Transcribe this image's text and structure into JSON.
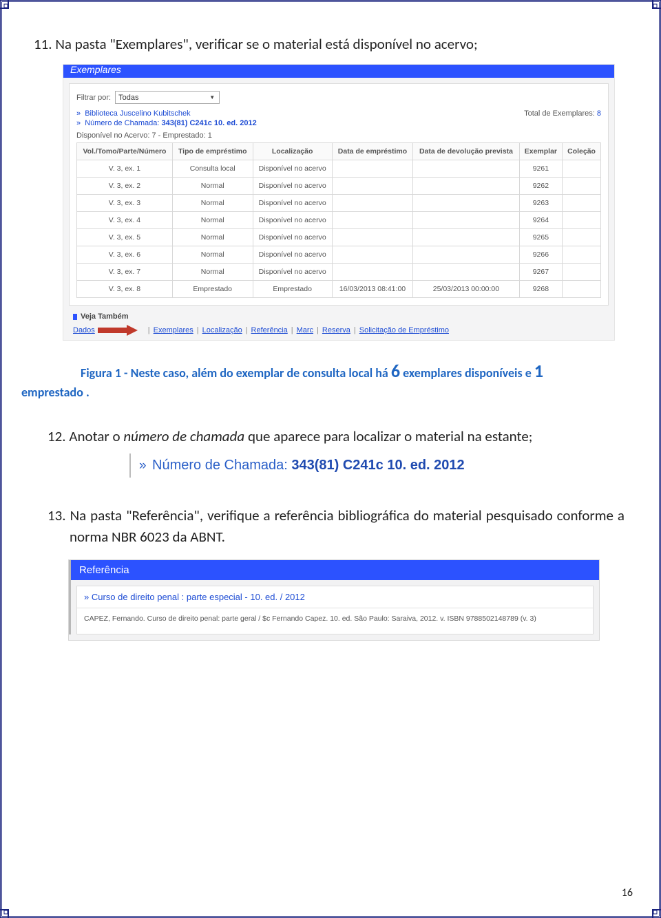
{
  "step11": "11. Na pasta \"Exemplares\", verificar se o material está disponível no acervo;",
  "step12_a": "12. Anotar o ",
  "step12_b": "número de chamada",
  "step12_c": " que aparece para localizar o material na estante;",
  "step13": "13. Na pasta \"Referência\", verifique a referência bibliográfica do material pesquisado conforme a norma NBR 6023 da ABNT.",
  "pageNumber": "16",
  "shot1": {
    "topbar": "Exemplares",
    "filterLabel": "Filtrar por:",
    "filterValue": "Todas",
    "libraryLine": "Biblioteca Juscelino Kubitschek",
    "totalLabel": "Total de Exemplares:",
    "totalValue": "8",
    "callLabel": "Número de Chamada:",
    "callValue": "343(81) C241c 10. ed. 2012",
    "availLine": "Disponível no Acervo: 7  -  Emprestado: 1",
    "headers": [
      "Vol./Tomo/Parte/Número",
      "Tipo de empréstimo",
      "Localização",
      "Data de empréstimo",
      "Data de devolução prevista",
      "Exemplar",
      "Coleção"
    ],
    "rows": [
      {
        "v": "V. 3, ex. 1",
        "t": "Consulta local",
        "l": "Disponível no acervo",
        "de": "",
        "dd": "",
        "ex": "9261",
        "c": ""
      },
      {
        "v": "V. 3, ex. 2",
        "t": "Normal",
        "l": "Disponível no acervo",
        "de": "",
        "dd": "",
        "ex": "9262",
        "c": ""
      },
      {
        "v": "V. 3, ex. 3",
        "t": "Normal",
        "l": "Disponível no acervo",
        "de": "",
        "dd": "",
        "ex": "9263",
        "c": ""
      },
      {
        "v": "V. 3, ex. 4",
        "t": "Normal",
        "l": "Disponível no acervo",
        "de": "",
        "dd": "",
        "ex": "9264",
        "c": ""
      },
      {
        "v": "V. 3, ex. 5",
        "t": "Normal",
        "l": "Disponível no acervo",
        "de": "",
        "dd": "",
        "ex": "9265",
        "c": ""
      },
      {
        "v": "V. 3, ex. 6",
        "t": "Normal",
        "l": "Disponível no acervo",
        "de": "",
        "dd": "",
        "ex": "9266",
        "c": ""
      },
      {
        "v": "V. 3, ex. 7",
        "t": "Normal",
        "l": "Disponível no acervo",
        "de": "",
        "dd": "",
        "ex": "9267",
        "c": ""
      },
      {
        "v": "V. 3, ex. 8",
        "t": "Emprestado",
        "l": "Emprestado",
        "de": "16/03/2013 08:41:00",
        "dd": "25/03/2013 00:00:00",
        "ex": "9268",
        "c": ""
      }
    ],
    "veja": "Veja Também",
    "tabs": [
      "Dados",
      "Exemplares",
      "Localização",
      "Referência",
      "Marc",
      "Reserva",
      "Solicitação de Empréstimo"
    ]
  },
  "caption": {
    "prefix": "Figura 1 - Neste caso, além do exemplar de consulta local há ",
    "six": "6",
    "mid": " exemplares disponíveis e ",
    "one": "1",
    "suffix": "emprestado ."
  },
  "snippet": {
    "label": "Número de Chamada: ",
    "value": "343(81) C241c 10. ed. 2012"
  },
  "shot2": {
    "bar": "Referência",
    "title": "» Curso de direito penal : parte especial - 10. ed. / 2012",
    "ref": "CAPEZ, Fernando. Curso de direito penal: parte geral / $c Fernando Capez. 10. ed. São Paulo: Saraiva, 2012. v. ISBN 9788502148789 (v. 3)"
  }
}
